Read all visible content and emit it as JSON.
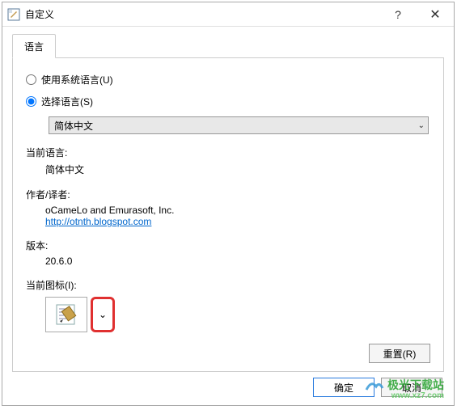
{
  "titlebar": {
    "title": "自定义",
    "help": "?",
    "close": "✕"
  },
  "tabs": {
    "language_tab": "语言"
  },
  "radios": {
    "use_system": "使用系统语言(U)",
    "select_lang": "选择语言(S)"
  },
  "language_select": {
    "value": "简体中文"
  },
  "labels": {
    "current_lang": "当前语言:",
    "current_lang_value": "简体中文",
    "author": "作者/译者:",
    "author_value": "oCameLo and Emurasoft, Inc.",
    "author_link": "http://otnth.blogspot.com",
    "version": "版本:",
    "version_value": "20.6.0",
    "current_icon": "当前图标(I):"
  },
  "buttons": {
    "reset": "重置(R)",
    "ok": "确定",
    "cancel": "取消"
  },
  "watermark": {
    "main": "极光下载站",
    "sub": "www.xz7.com"
  }
}
